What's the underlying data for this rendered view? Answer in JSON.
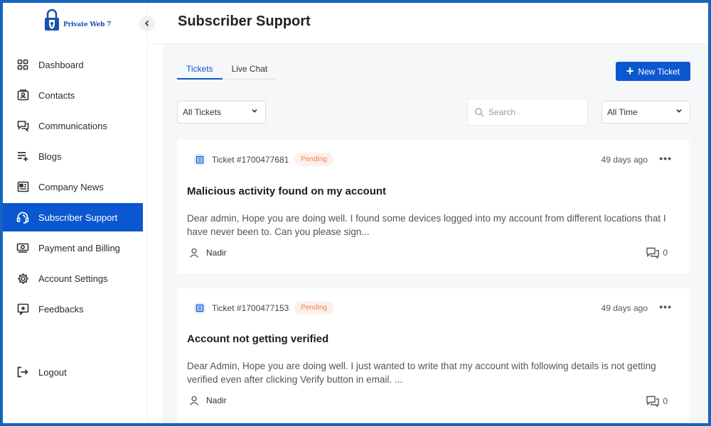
{
  "app": {
    "brand": "Private Web 7",
    "page_title": "Subscriber Support"
  },
  "sidebar": {
    "collapse_icon": "chevron-left-icon",
    "items": [
      {
        "label": "Dashboard",
        "icon": "grid-icon"
      },
      {
        "label": "Contacts",
        "icon": "contact-card-icon"
      },
      {
        "label": "Communications",
        "icon": "chat-icon"
      },
      {
        "label": "Blogs",
        "icon": "list-add-icon"
      },
      {
        "label": "Company News",
        "icon": "news-icon"
      },
      {
        "label": "Subscriber Support",
        "icon": "headset-icon",
        "active": true
      },
      {
        "label": "Payment and Billing",
        "icon": "money-icon"
      },
      {
        "label": "Account Settings",
        "icon": "gear-icon"
      },
      {
        "label": "Feedbacks",
        "icon": "feedback-star-icon"
      }
    ],
    "logout": {
      "label": "Logout",
      "icon": "logout-icon"
    }
  },
  "tabs": [
    {
      "label": "Tickets",
      "active": true
    },
    {
      "label": "Live Chat",
      "active": false
    }
  ],
  "toolbar": {
    "new_ticket_label": "New Ticket",
    "filter_selected": "All Tickets",
    "search_placeholder": "Search",
    "time_selected": "All Time"
  },
  "tickets": [
    {
      "id": "Ticket #1700477681",
      "status": "Pending",
      "age": "49 days ago",
      "title": "Malicious activity found on my account",
      "body": "Dear admin, Hope you are doing well. I found some devices logged into my account from different locations that I have never been to. Can you please sign...",
      "author": "Nadir",
      "comments": "0"
    },
    {
      "id": "Ticket #1700477153",
      "status": "Pending",
      "age": "49 days ago",
      "title": "Account not getting verified",
      "body": "Dear Admin, Hope you are doing well. I just wanted to write that my account with following details is not getting verified even after clicking Verify button in email. ...",
      "author": "Nadir",
      "comments": "0"
    }
  ],
  "colors": {
    "accent": "#0b57d0",
    "pending_bg": "#fdf0ea",
    "pending_text": "#e8835a",
    "frame_border": "#1565c0"
  }
}
